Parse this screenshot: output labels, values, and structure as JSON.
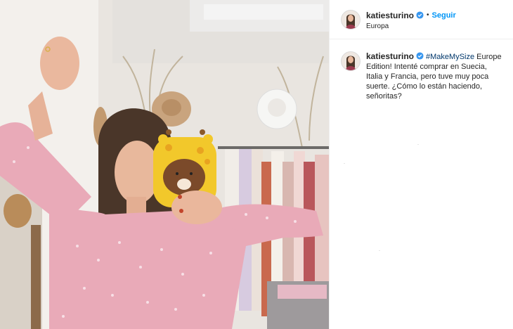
{
  "post": {
    "username": "katiesturino",
    "follow_label": "Seguir",
    "separator": "•",
    "location": "Europa",
    "caption": {
      "hashtag": "#MakeMySize",
      "text": " Europe Edition! Intenté comprar en Suecia, Italia y Francia, pero tuve muy poca suerte. ¿Cómo lo están haciendo, señoritas?"
    }
  },
  "colors": {
    "follow_blue": "#0095f6",
    "hashtag_blue": "#00376b",
    "verified_blue": "#3897f0",
    "text": "#262626"
  },
  "icons": {
    "verified": "verified-badge-icon"
  }
}
